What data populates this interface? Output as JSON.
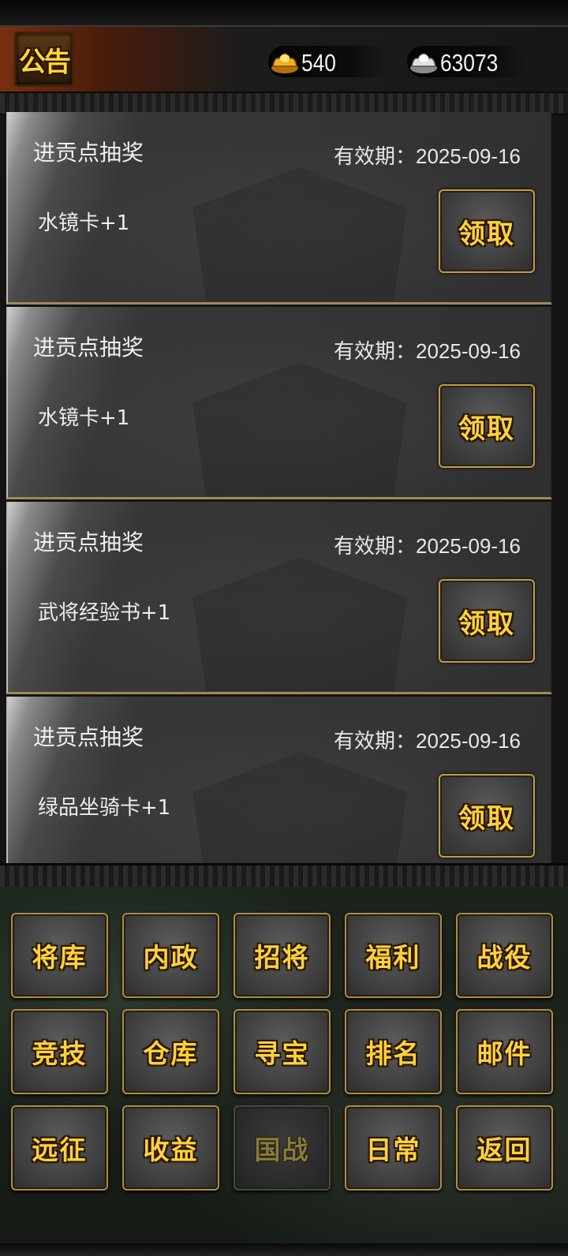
{
  "header": {
    "title": "公告",
    "gold": "540",
    "silver": "63073",
    "gold_icon": "gold-ingot-icon",
    "silver_icon": "silver-ingot-icon"
  },
  "cards": [
    {
      "title": "进贡点抽奖",
      "expiry": "有效期：2025-09-16",
      "reward": "水镜卡+1",
      "button": "领取"
    },
    {
      "title": "进贡点抽奖",
      "expiry": "有效期：2025-09-16",
      "reward": "水镜卡+1",
      "button": "领取"
    },
    {
      "title": "进贡点抽奖",
      "expiry": "有效期：2025-09-16",
      "reward": "武将经验书+1",
      "button": "领取"
    },
    {
      "title": "进贡点抽奖",
      "expiry": "有效期：2025-09-16",
      "reward": "绿品坐骑卡+1",
      "button": "领取"
    }
  ],
  "menu": {
    "row1": [
      "将库",
      "内政",
      "招将",
      "福利",
      "战役"
    ],
    "row2": [
      "竞技",
      "仓库",
      "寻宝",
      "排名",
      "邮件"
    ],
    "row3": [
      "远征",
      "收益",
      "国战",
      "日常",
      "返回"
    ]
  },
  "colors": {
    "button_text": "#ffd23a",
    "button_border": "#c89a3a",
    "disabled_text": "#8a7a3a"
  }
}
